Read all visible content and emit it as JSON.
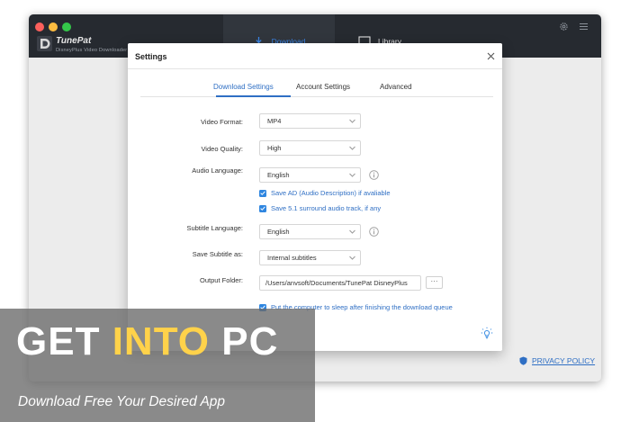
{
  "app": {
    "brand_name": "TunePat",
    "brand_subtitle": "DisneyPlus Video Downloader",
    "nav": {
      "download_label": "Download",
      "library_label": "Library"
    },
    "privacy_policy_label": "PRIVACY POLICY"
  },
  "dialog": {
    "title": "Settings",
    "tabs": [
      {
        "label": "Download Settings",
        "active": true
      },
      {
        "label": "Account Settings",
        "active": false
      },
      {
        "label": "Advanced",
        "active": false
      }
    ],
    "fields": {
      "video_format": {
        "label": "Video Format:",
        "value": "MP4"
      },
      "video_quality": {
        "label": "Video Quality:",
        "value": "High"
      },
      "audio_language": {
        "label": "Audio Language:",
        "value": "English"
      },
      "subtitle_language": {
        "label": "Subtitle Language:",
        "value": "English"
      },
      "save_subtitle": {
        "label": "Save Subtitle as:",
        "value": "Internal subtitles"
      },
      "output_folder": {
        "label": "Output Folder:",
        "value": "/Users/anvsoft/Documents/TunePat DisneyPlus",
        "browse_label": "···"
      }
    },
    "checkboxes": {
      "save_ad": {
        "label": "Save AD (Audio Description) if avaliable",
        "checked": true
      },
      "save_51": {
        "label": "Save 5.1 surround audio track, if any",
        "checked": true
      },
      "sleep": {
        "label": "Put the computer to sleep after finishing the download queue",
        "checked": true
      }
    }
  },
  "watermark": {
    "title_part1": "GET ",
    "title_highlight": "INTO",
    "title_part2": " PC",
    "subtitle": "Download Free Your Desired App"
  },
  "icons": [
    "logo-icon",
    "download-icon",
    "library-icon",
    "gear-icon",
    "menu-icon",
    "close-icon",
    "chevron-down-icon",
    "info-icon",
    "check-icon",
    "shield-icon",
    "lightbulb-icon"
  ],
  "colors": {
    "accent": "#2f6fc4",
    "header_bg": "#262a30",
    "checkbox": "#2f86e0",
    "watermark_highlight": "#ffd24a"
  }
}
